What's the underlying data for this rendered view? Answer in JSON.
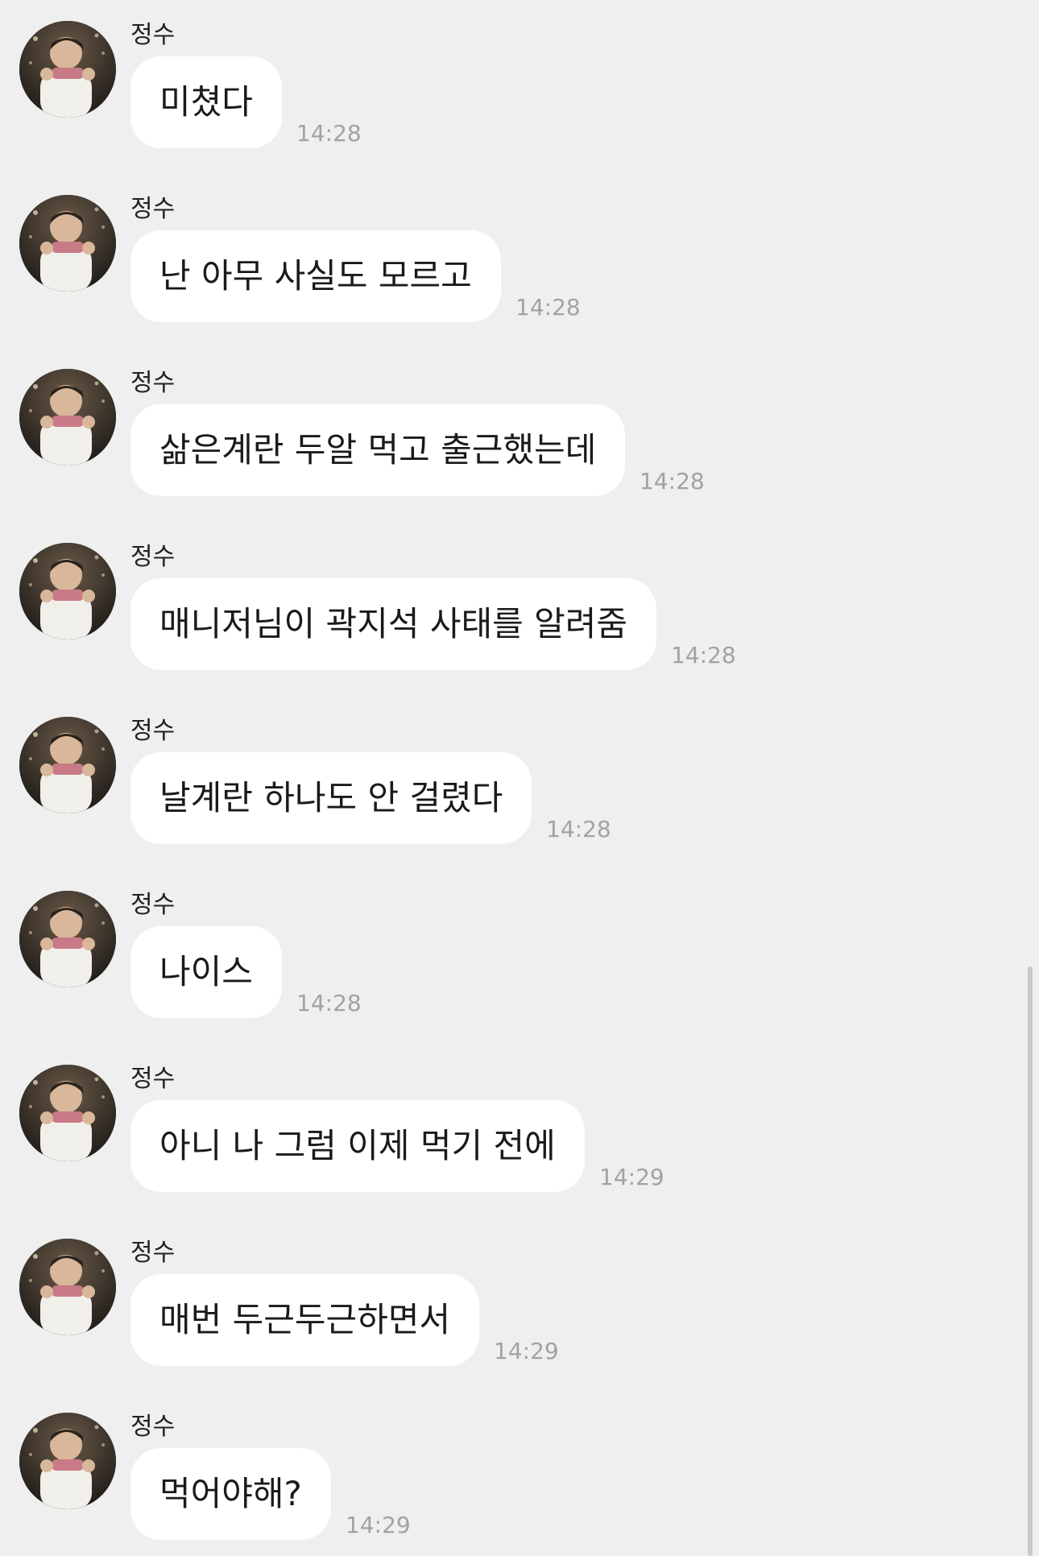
{
  "chat": {
    "messages": [
      {
        "sender": "정수",
        "text": "미쳤다",
        "time": "14:28",
        "avatar_icon": "profile-photo"
      },
      {
        "sender": "정수",
        "text": "난 아무 사실도 모르고",
        "time": "14:28",
        "avatar_icon": "profile-photo"
      },
      {
        "sender": "정수",
        "text": "삶은계란 두알 먹고 출근했는데",
        "time": "14:28",
        "avatar_icon": "profile-photo"
      },
      {
        "sender": "정수",
        "text": "매니저님이 곽지석 사태를 알려줌",
        "time": "14:28",
        "avatar_icon": "profile-photo"
      },
      {
        "sender": "정수",
        "text": "날계란 하나도 안 걸렸다",
        "time": "14:28",
        "avatar_icon": "profile-photo"
      },
      {
        "sender": "정수",
        "text": "나이스",
        "time": "14:28",
        "avatar_icon": "profile-photo"
      },
      {
        "sender": "정수",
        "text": "아니 나 그럼 이제 먹기 전에",
        "time": "14:29",
        "avatar_icon": "profile-photo"
      },
      {
        "sender": "정수",
        "text": "매번 두근두근하면서",
        "time": "14:29",
        "avatar_icon": "profile-photo"
      },
      {
        "sender": "정수",
        "text": "먹어야해?",
        "time": "14:29",
        "avatar_icon": "profile-photo"
      }
    ]
  },
  "colors": {
    "background": "#efefef",
    "bubble": "#ffffff",
    "timestamp": "#a2a2a2",
    "text": "#1a1a1a"
  }
}
